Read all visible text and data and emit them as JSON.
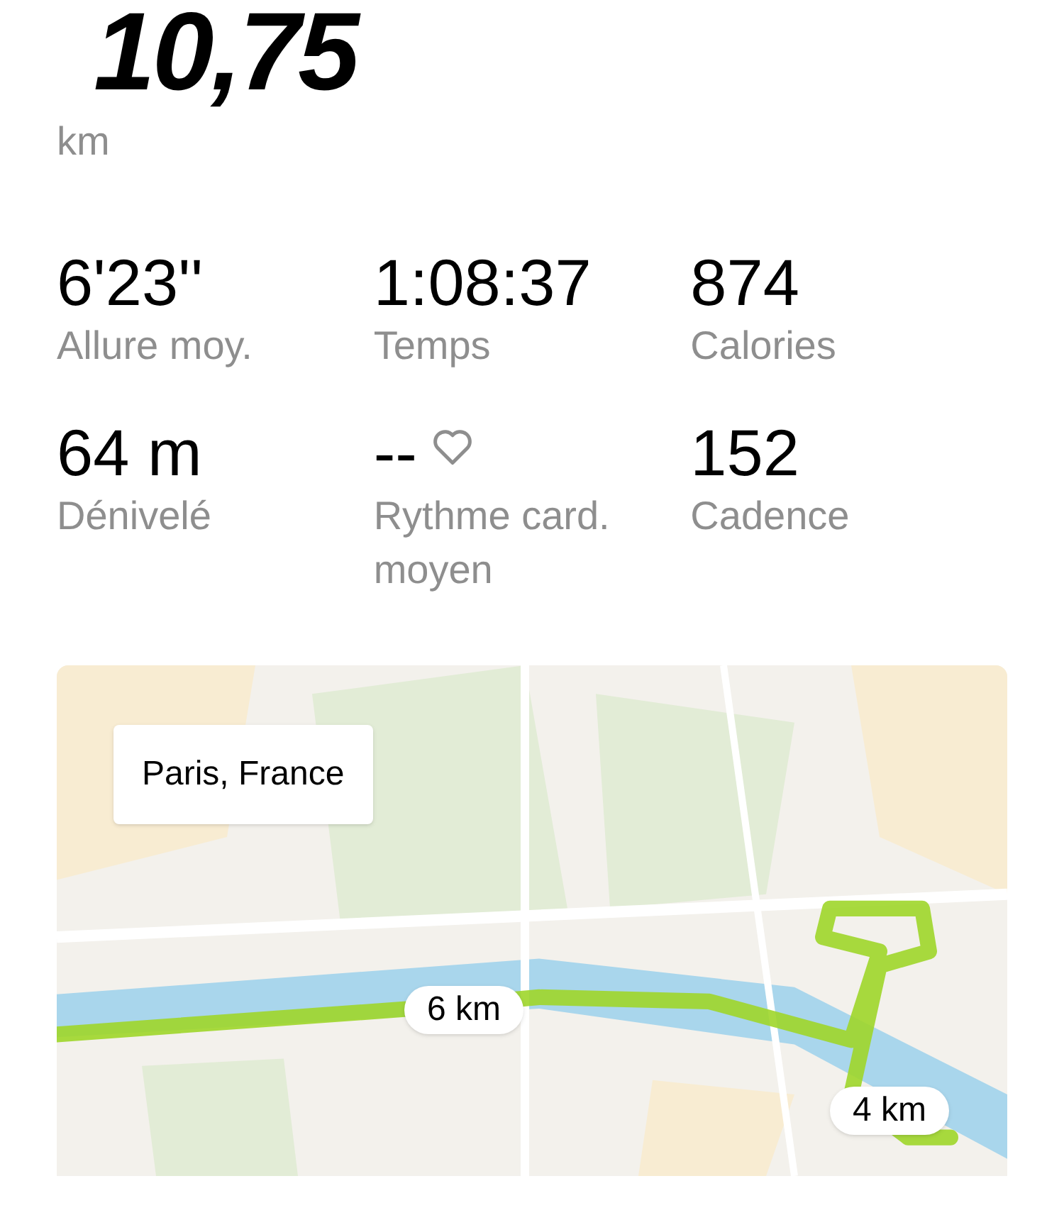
{
  "distance": {
    "value": "10,75",
    "unit": "km"
  },
  "stats": [
    {
      "kind": "plain",
      "value": "6'23''",
      "label": "Allure moy."
    },
    {
      "kind": "plain",
      "value": "1:08:37",
      "label": "Temps"
    },
    {
      "kind": "plain",
      "value": "874",
      "label": "Calories"
    },
    {
      "kind": "plain",
      "value": "64 m",
      "label": "Dénivelé"
    },
    {
      "kind": "heart",
      "value": "--",
      "label": "Rythme card. moyen"
    },
    {
      "kind": "plain",
      "value": "152",
      "label": "Cadence"
    }
  ],
  "map": {
    "location": "Paris, France",
    "markers": [
      "6 km",
      "4 km"
    ]
  }
}
